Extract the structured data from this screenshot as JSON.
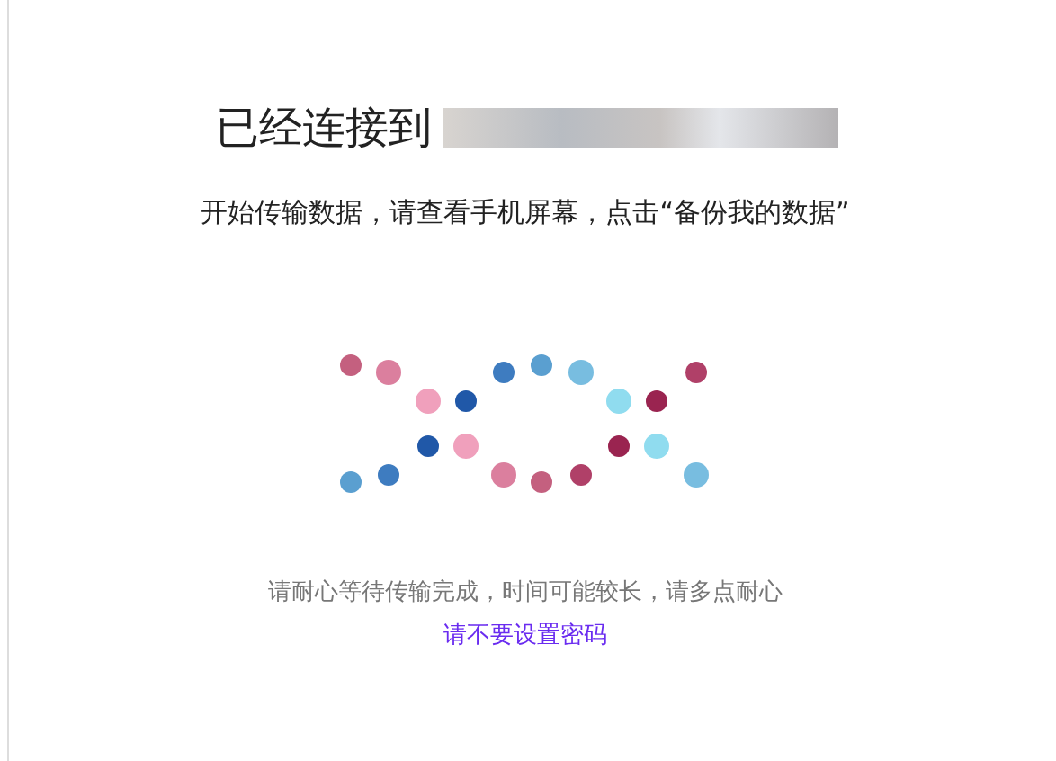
{
  "heading": {
    "label": "已经连接到"
  },
  "instruction": "开始传输数据，请查看手机屏幕，点击“备份我的数据”",
  "wait_note": "请耐心等待传输完成，时间可能较长，请多点耐心",
  "password_link": "请不要设置密码"
}
